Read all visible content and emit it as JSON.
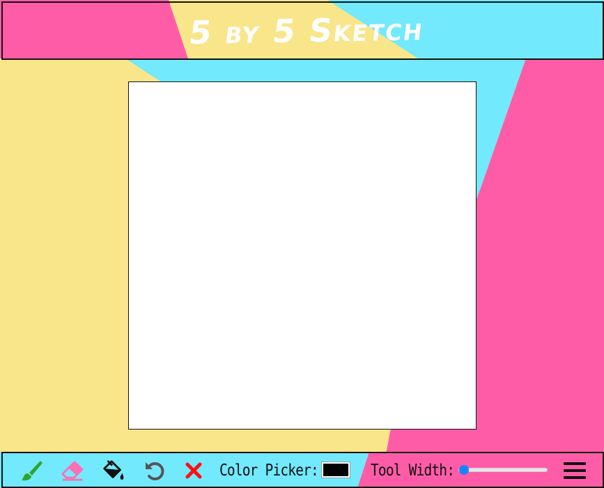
{
  "app": {
    "title": "5 by 5 Sketch"
  },
  "toolbar": {
    "tools": [
      {
        "name": "brush",
        "icon": "paintbrush-icon",
        "color": "#2fa52f"
      },
      {
        "name": "eraser",
        "icon": "eraser-icon",
        "color": "#ff6fb4"
      },
      {
        "name": "fill",
        "icon": "paint-bucket-icon",
        "color": "#111111"
      },
      {
        "name": "undo",
        "icon": "undo-icon",
        "color": "#555555"
      },
      {
        "name": "clear",
        "icon": "close-icon",
        "color": "#ff1010"
      }
    ],
    "color_picker_label": "Color Picker:",
    "color_value": "#000000",
    "tool_width_label": "Tool Width:",
    "tool_width_level": 0,
    "menu_icon": "hamburger-menu-icon"
  },
  "colors": {
    "pink": "#ff5ca8",
    "yellow": "#f9e58a",
    "cyan": "#72e9fc"
  }
}
